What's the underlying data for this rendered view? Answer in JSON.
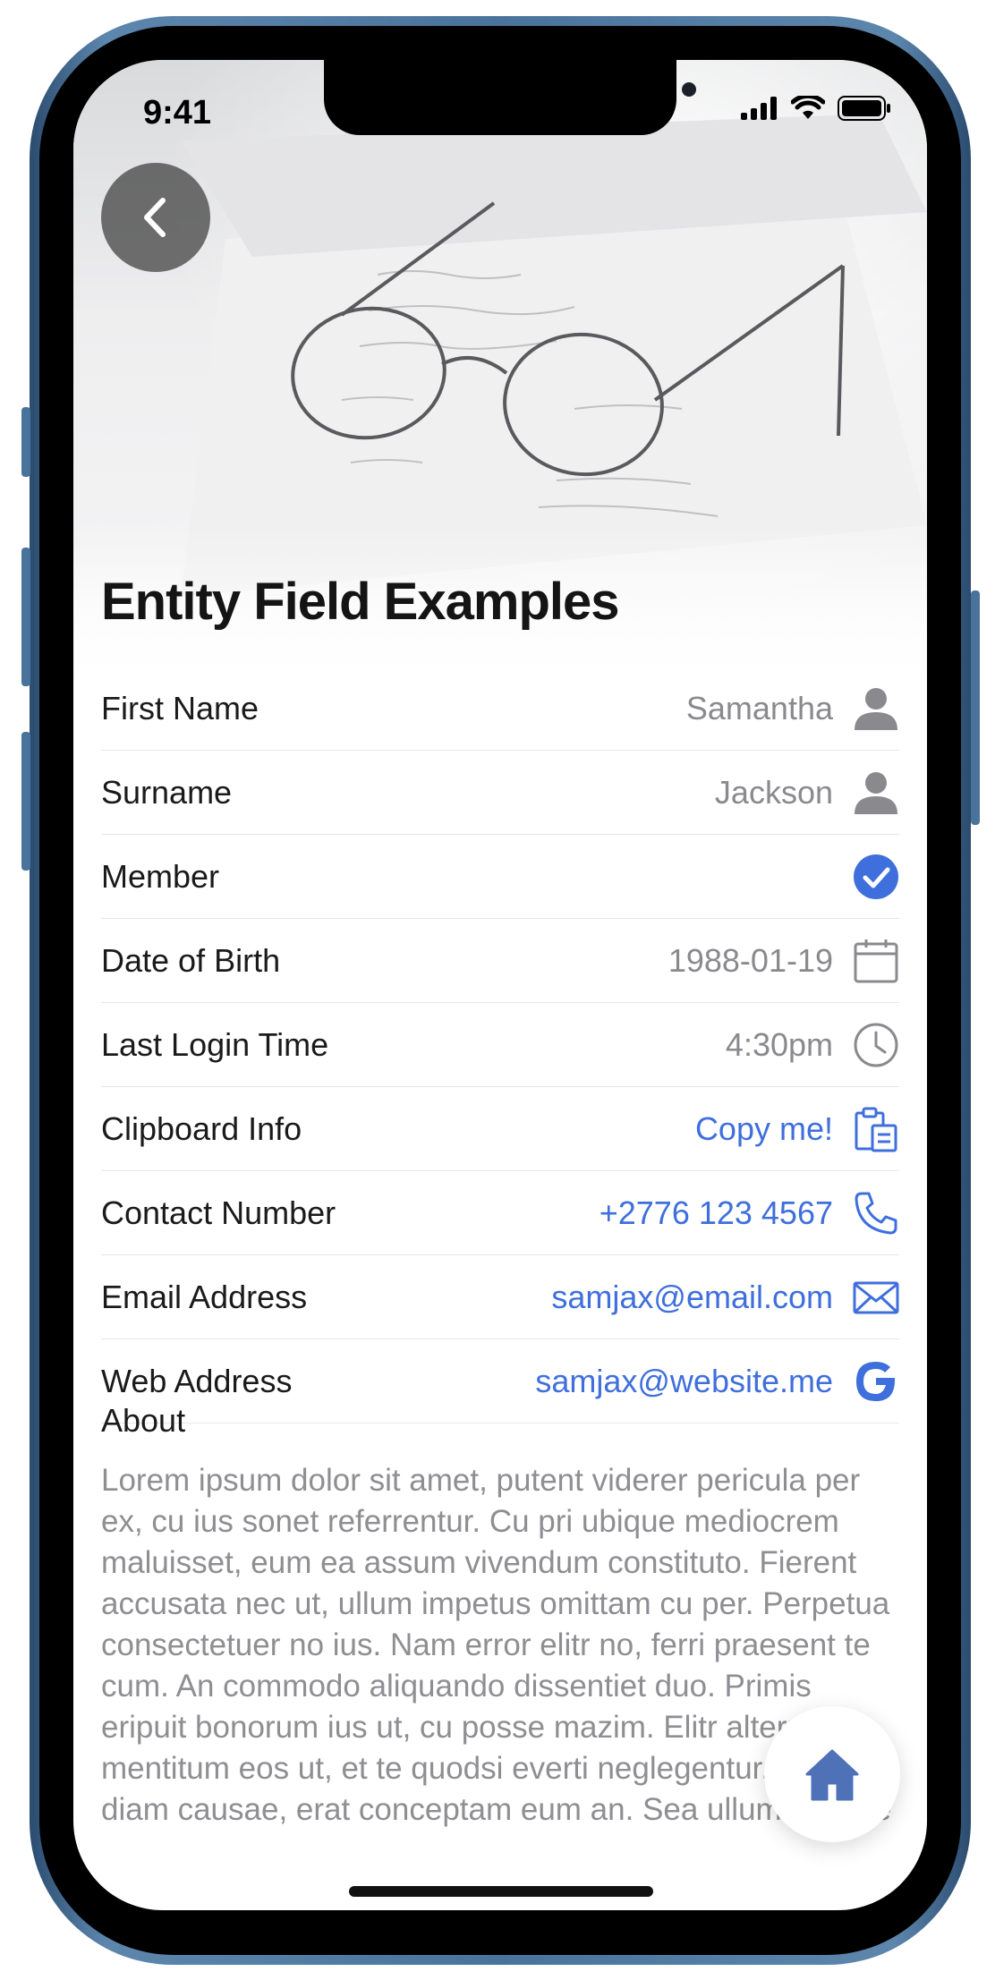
{
  "status_bar": {
    "time": "9:41"
  },
  "header": {
    "title": "Entity Field Examples"
  },
  "fields": [
    {
      "label": "First Name",
      "value": "Samantha",
      "icon": "person-icon",
      "value_style": "muted"
    },
    {
      "label": "Surname",
      "value": "Jackson",
      "icon": "person-icon",
      "value_style": "muted"
    },
    {
      "label": "Member",
      "value": "",
      "icon": "checkmark-circle-icon",
      "value_style": "muted"
    },
    {
      "label": "Date of Birth",
      "value": "1988-01-19",
      "icon": "calendar-icon",
      "value_style": "muted"
    },
    {
      "label": "Last Login Time",
      "value": "4:30pm",
      "icon": "clock-icon",
      "value_style": "muted"
    },
    {
      "label": "Clipboard Info",
      "value": "Copy me!",
      "icon": "clipboard-icon",
      "value_style": "link"
    },
    {
      "label": "Contact Number",
      "value": "+2776 123 4567",
      "icon": "phone-icon",
      "value_style": "link"
    },
    {
      "label": "Email Address",
      "value": "samjax@email.com",
      "icon": "envelope-icon",
      "value_style": "link"
    },
    {
      "label": "Web Address",
      "value": "samjax@website.me",
      "icon": "google-icon",
      "value_style": "link"
    }
  ],
  "about": {
    "label": "About",
    "text": "Lorem ipsum dolor sit amet, putent viderer pericula per ex, cu ius sonet referrentur. Cu pri ubique mediocrem maluisset, eum ea assum vivendum constituto. Fierent accusata nec ut, ullum impetus omittam cu per. Perpetua consectetuer no ius. Nam error elitr no, ferri praesent te cum. An commodo aliquando dissentiet duo. Primis eripuit bonorum ius ut, cu posse mazim. Elitr alterum mentitum eos ut, et te quodsi everti neglegentur. Est in diam causae, erat conceptam eum an. Sea ullum causae"
  },
  "colors": {
    "accent": "#3F6FDC",
    "muted_text": "#8A8A8E",
    "icon_gray": "#8A8A8E",
    "member_check": "#3F6FDC"
  }
}
